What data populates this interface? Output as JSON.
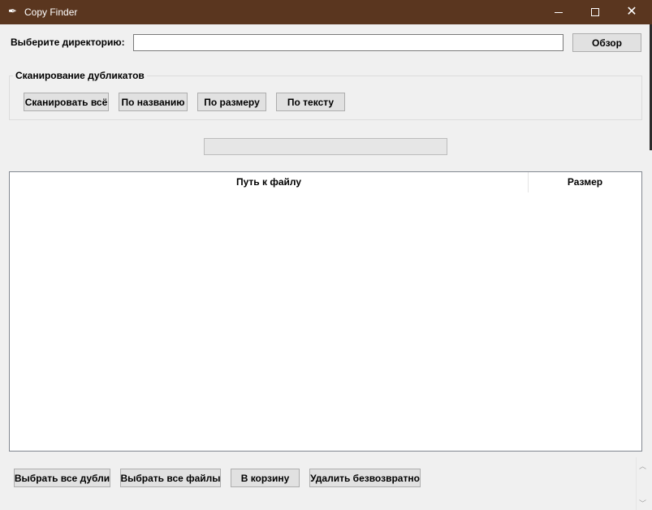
{
  "window": {
    "title": "Copy Finder",
    "icons": {
      "app": "feather-icon",
      "minimize": "minimize-icon",
      "maximize": "maximize-icon",
      "close": "close-icon"
    },
    "colors": {
      "titlebar": "#5a361f",
      "background": "#f0f0f0"
    }
  },
  "directory": {
    "label": "Выберите директорию:",
    "value": "",
    "placeholder": "",
    "browse_label": "Обзор"
  },
  "scan_group": {
    "legend": "Сканирование дубликатов",
    "buttons": {
      "scan_all": "Сканировать всё",
      "by_name": "По названию",
      "by_size": "По размеру",
      "by_text": "По тексту"
    }
  },
  "progress": {
    "value": 0
  },
  "table": {
    "columns": {
      "path": "Путь к файлу",
      "size": "Размер"
    },
    "rows": []
  },
  "actions": {
    "select_duplicates": "Выбрать все дубли",
    "select_all_files": "Выбрать все файлы",
    "to_trash": "В корзину",
    "delete_permanently": "Удалить безвозвратно"
  }
}
